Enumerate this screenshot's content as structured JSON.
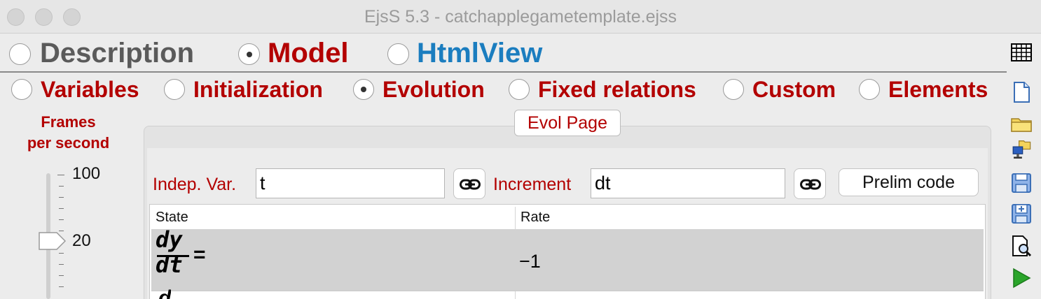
{
  "window": {
    "title": "EjsS 5.3 - catchapplegametemplate.ejss"
  },
  "main_tabs": [
    {
      "label": "Description",
      "selected": false,
      "color": "#5a5a5a"
    },
    {
      "label": "Model",
      "selected": true,
      "color": "#b30000"
    },
    {
      "label": "HtmlView",
      "selected": false,
      "color": "#1b7dbf"
    }
  ],
  "sub_tabs": [
    {
      "label": "Variables",
      "selected": false
    },
    {
      "label": "Initialization",
      "selected": false
    },
    {
      "label": "Evolution",
      "selected": true
    },
    {
      "label": "Fixed relations",
      "selected": false
    },
    {
      "label": "Custom",
      "selected": false
    },
    {
      "label": "Elements",
      "selected": false
    }
  ],
  "fps": {
    "label_line1": "Frames",
    "label_line2": "per second",
    "ticks": [
      "100",
      "20"
    ],
    "value": 20
  },
  "evolution": {
    "page_button": "Evol Page",
    "indep_var_label": "Indep. Var.",
    "indep_var_value": "t",
    "increment_label": "Increment",
    "increment_value": "dt",
    "prelim_button": "Prelim code"
  },
  "ode_table": {
    "columns": [
      "State",
      "Rate"
    ],
    "rows": [
      {
        "numerator": "dy",
        "denominator": "dt",
        "equals": "=",
        "rate": "−1"
      },
      {
        "numerator": "d",
        "denominator": "",
        "equals": "",
        "rate": ""
      }
    ]
  },
  "toolbar_icons": [
    "table-icon",
    "new-file-icon",
    "open-folder-icon",
    "open-remote-icon",
    "save-icon",
    "save-as-icon",
    "search-document-icon",
    "run-icon"
  ],
  "colors": {
    "accent_red": "#b30000",
    "accent_blue": "#1b7dbf",
    "run_green": "#2aa52a"
  }
}
